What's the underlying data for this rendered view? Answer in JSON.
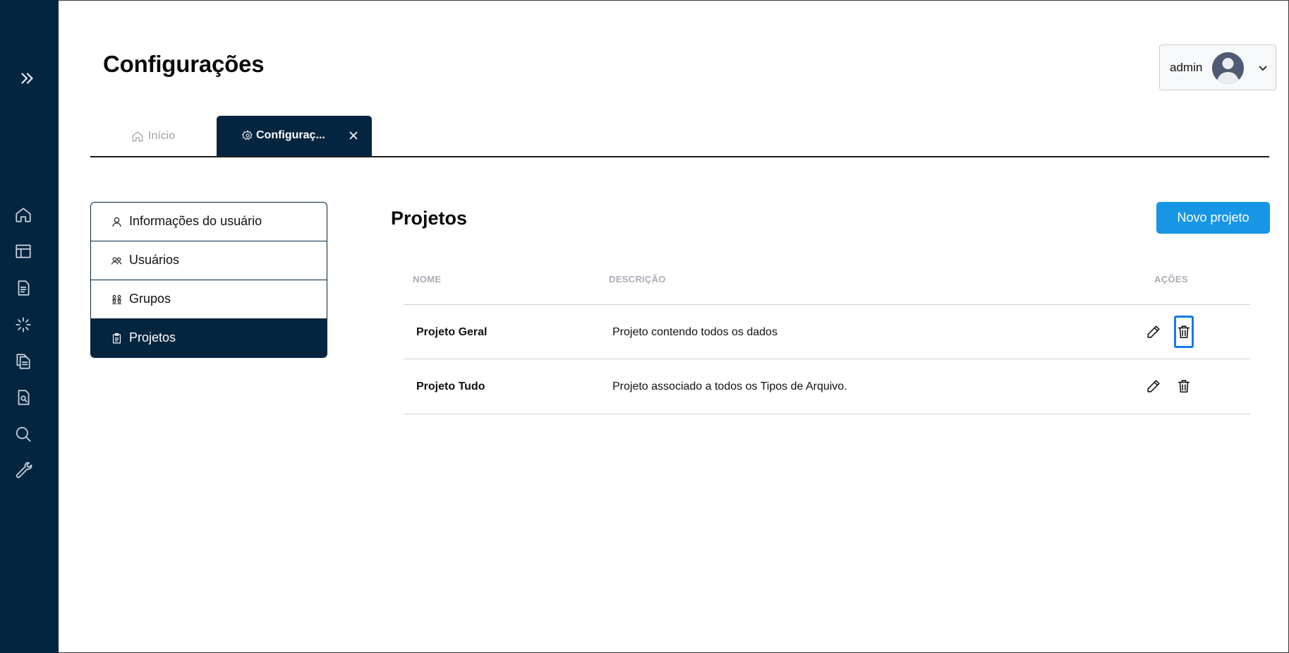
{
  "header": {
    "title": "Configurações"
  },
  "user_menu": {
    "name": "admin",
    "avatar_icon": "user-avatar-icon",
    "caret_icon": "chevron-down-icon"
  },
  "sidebar": {
    "expand_icon": "double-chevron-right-icon",
    "items": [
      {
        "icon": "home-icon"
      },
      {
        "icon": "layout-icon"
      },
      {
        "icon": "document-icon"
      },
      {
        "icon": "loader-icon"
      },
      {
        "icon": "files-icon"
      },
      {
        "icon": "file-search-icon"
      },
      {
        "icon": "search-icon"
      },
      {
        "icon": "wrench-icon"
      }
    ]
  },
  "tabs": [
    {
      "label": "Início",
      "icon": "home-icon",
      "active": false
    },
    {
      "label": "Configuraç...",
      "icon": "gear-icon",
      "active": true,
      "closable": true
    }
  ],
  "settings_menu": {
    "items": [
      {
        "label": "Informações do usuário",
        "icon": "user-icon"
      },
      {
        "label": "Usuários",
        "icon": "users-icon"
      },
      {
        "label": "Grupos",
        "icon": "groups-icon"
      },
      {
        "label": "Projetos",
        "icon": "clipboard-icon",
        "active": true
      }
    ]
  },
  "projects": {
    "title": "Projetos",
    "new_button": "Novo projeto",
    "columns": [
      "NOME",
      "DESCRIÇÃO",
      "AÇÕES"
    ],
    "rows": [
      {
        "name": "Projeto Geral",
        "description": "Projeto contendo todos os dados"
      },
      {
        "name": "Projeto Tudo",
        "description": "Projeto associado a todos os Tipos de Arquivo."
      }
    ]
  },
  "colors": {
    "sidebar": "#042540",
    "primary_button": "#1796e6",
    "focus_ring": "#1479f0"
  }
}
